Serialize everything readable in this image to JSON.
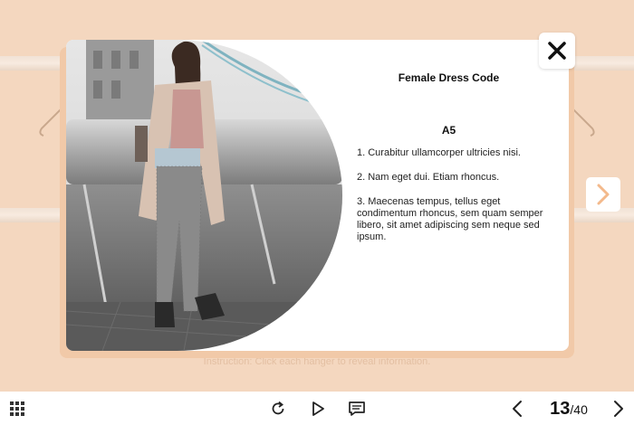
{
  "modal": {
    "title": "Female Dress Code",
    "section_heading": "A5",
    "points": [
      "1. Curabitur ullamcorper ultricies nisi.",
      "2. Nam eget dui. Etiam rhoncus.",
      "3. Maecenas tempus, tellus eget condimentum rhoncus, sem quam semper libero, sit amet adipiscing sem neque sed ipsum."
    ]
  },
  "instruction": "Instruction: Click each hanger to reveal information.",
  "toolbar": {
    "page_current": "13",
    "page_separator": "/",
    "page_total": "40"
  },
  "colors": {
    "background": "#f4d7bf",
    "accent": "#f3b98b",
    "text": "#111111"
  },
  "icons": {
    "menu": "grid-icon",
    "replay": "replay-icon",
    "play": "play-icon",
    "notes": "notes-icon",
    "prev": "chevron-left-icon",
    "next": "chevron-right-icon",
    "close": "close-icon"
  }
}
